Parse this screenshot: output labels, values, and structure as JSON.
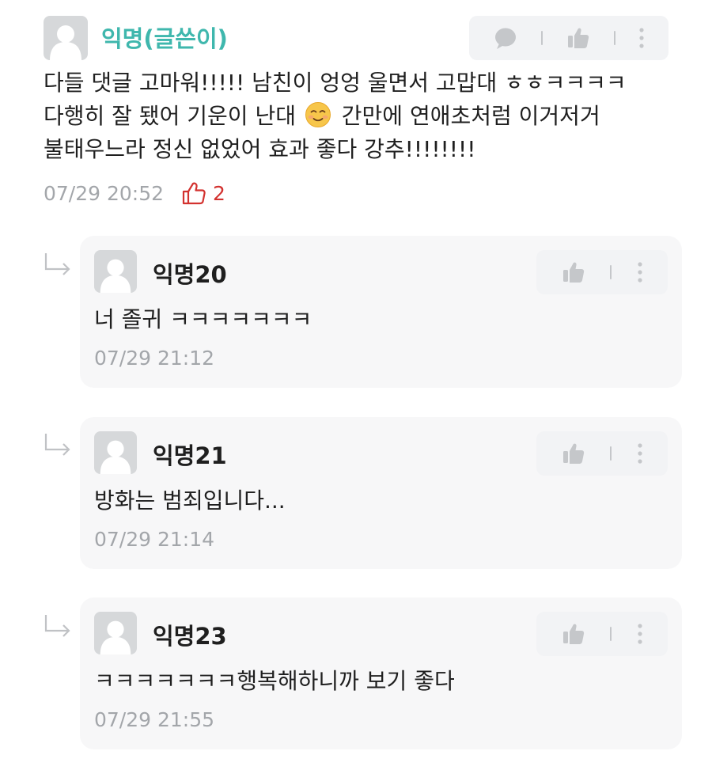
{
  "colors": {
    "author_name": "#3fb7ad",
    "like_active": "#d3322f",
    "muted_text": "#a3a6aa",
    "reply_card_bg": "#f7f7f8",
    "action_bar_bg": "#f2f3f5"
  },
  "main_comment": {
    "author": "익명(글쓴이)",
    "lines": [
      "다들 댓글 고마워!!!!! 남친이 엉엉 울면서 고맙대 ㅎㅎㅋㅋㅋㅋ",
      "다행히 잘 됐어 기운이 난대",
      "간만에 연애초처럼 이거저거",
      "불태우느라 정신 없었어 효과 좋다 강추!!!!!!!!"
    ],
    "emoji": "smiling-face-emoji",
    "time": "07/29 20:52",
    "like_count": "2",
    "actions": [
      "reply-icon",
      "like-icon",
      "more-icon"
    ]
  },
  "replies": [
    {
      "author": "익명20",
      "text": "너 졸귀 ㅋㅋㅋㅋㅋㅋㅋ",
      "time": "07/29 21:12",
      "actions": [
        "like-icon",
        "more-icon"
      ]
    },
    {
      "author": "익명21",
      "text": "방화는 범죄입니다...",
      "time": "07/29 21:14",
      "actions": [
        "like-icon",
        "more-icon"
      ]
    },
    {
      "author": "익명23",
      "text": "ㅋㅋㅋㅋㅋㅋㅋ행복해하니까 보기 좋다",
      "time": "07/29 21:55",
      "actions": [
        "like-icon",
        "more-icon"
      ]
    }
  ]
}
